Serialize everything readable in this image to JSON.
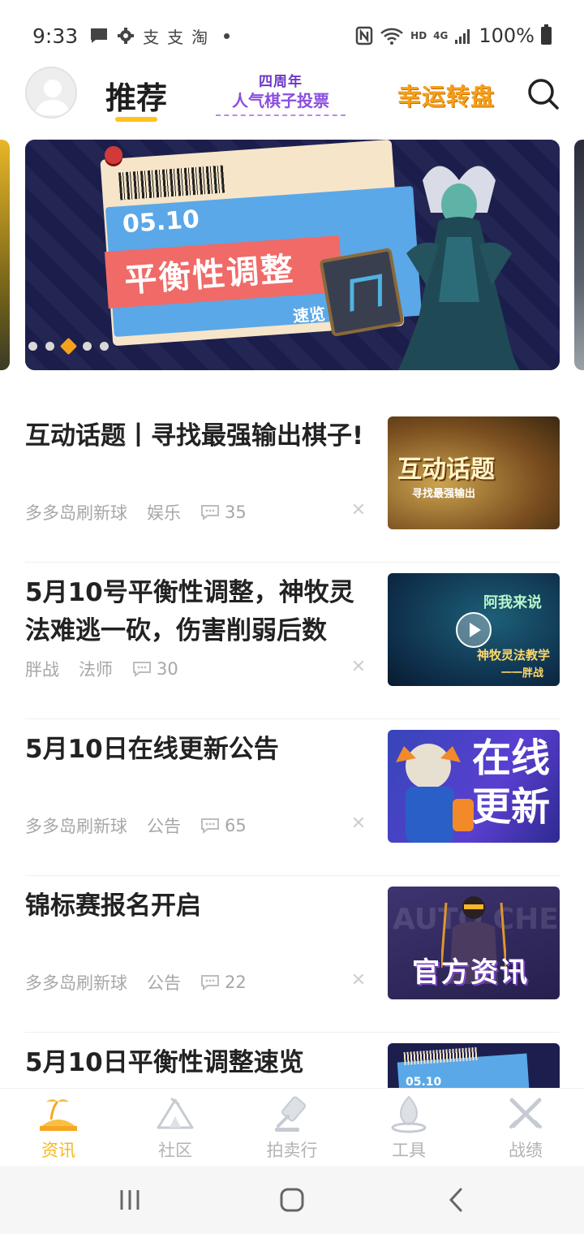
{
  "status_bar": {
    "time": "9:33",
    "left_icons": [
      "message-icon",
      "gear-icon",
      "alipay-icon",
      "alipay-icon",
      "taobao-icon"
    ],
    "hd_label": "HD",
    "network_label": "4G",
    "battery_percent": "100%"
  },
  "top_nav": {
    "main_tab": "推荐",
    "vote_promo_line1": "四周年",
    "vote_promo_line2": "人气棋子投票",
    "wheel_promo": "幸运转盘"
  },
  "banner": {
    "date": "05.10",
    "title": "平衡性调整",
    "subtitle": "速览",
    "dot_count": 5,
    "active_dot": 2
  },
  "articles": [
    {
      "title": "互动话题丨寻找最强输出棋子!",
      "author": "多多岛刷新球",
      "category": "娱乐",
      "comments": "35",
      "thumb_line1": "互动话题",
      "thumb_line2": "寻找最强输出"
    },
    {
      "title": "5月10号平衡性调整，神牧灵法难逃一砍，伤害削弱后数",
      "author": "胖战",
      "category": "法师",
      "comments": "30",
      "thumb_line1": "阿我来说",
      "thumb_line2": "神牧灵法教学",
      "thumb_line3": "一一胖战"
    },
    {
      "title": "5月10日在线更新公告",
      "author": "多多岛刷新球",
      "category": "公告",
      "comments": "65",
      "thumb_line1": "在线",
      "thumb_line2": "更新"
    },
    {
      "title": "锦标赛报名开启",
      "author": "多多岛刷新球",
      "category": "公告",
      "comments": "22",
      "thumb_line1": "AUTO CHESS",
      "thumb_line2": "官方资讯"
    },
    {
      "title": "5月10日平衡性调整速览",
      "author": "",
      "category": "",
      "comments": "",
      "thumb_line1": "05.10"
    }
  ],
  "bottom_nav": {
    "tabs": [
      {
        "label": "资讯",
        "icon": "island-icon",
        "active": true
      },
      {
        "label": "社区",
        "icon": "tent-icon",
        "active": false
      },
      {
        "label": "拍卖行",
        "icon": "gavel-icon",
        "active": false
      },
      {
        "label": "工具",
        "icon": "campfire-icon",
        "active": false
      },
      {
        "label": "战绩",
        "icon": "crossed-swords-icon",
        "active": false
      }
    ]
  },
  "colors": {
    "accent": "#f6b81f",
    "vote_purple": "#8a4ee0",
    "wheel_orange": "#f5a019"
  }
}
